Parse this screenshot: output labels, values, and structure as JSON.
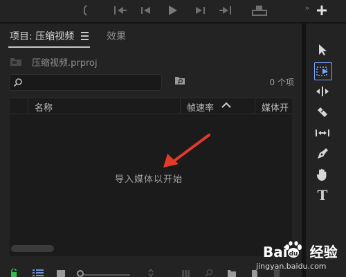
{
  "panel": {
    "tab_project": "项目: 压缩视频",
    "tab_effects": "效果",
    "project_file": "压缩视频.prproj",
    "search_placeholder": "",
    "item_count": "0 个项",
    "columns": {
      "name": "名称",
      "frame_rate": "帧速率",
      "media_start": "媒体开"
    },
    "empty_message": "导入媒体以开始"
  },
  "watermark": {
    "logo": "Bai 经验",
    "url": "jingyan.baidu.com"
  },
  "colors": {
    "panel_bg": "#232323",
    "list_bg": "#1b1b1b",
    "accent_blue": "#7aa6ff",
    "arrow_red": "#e5392a",
    "lock_green": "#2fbf4a"
  }
}
